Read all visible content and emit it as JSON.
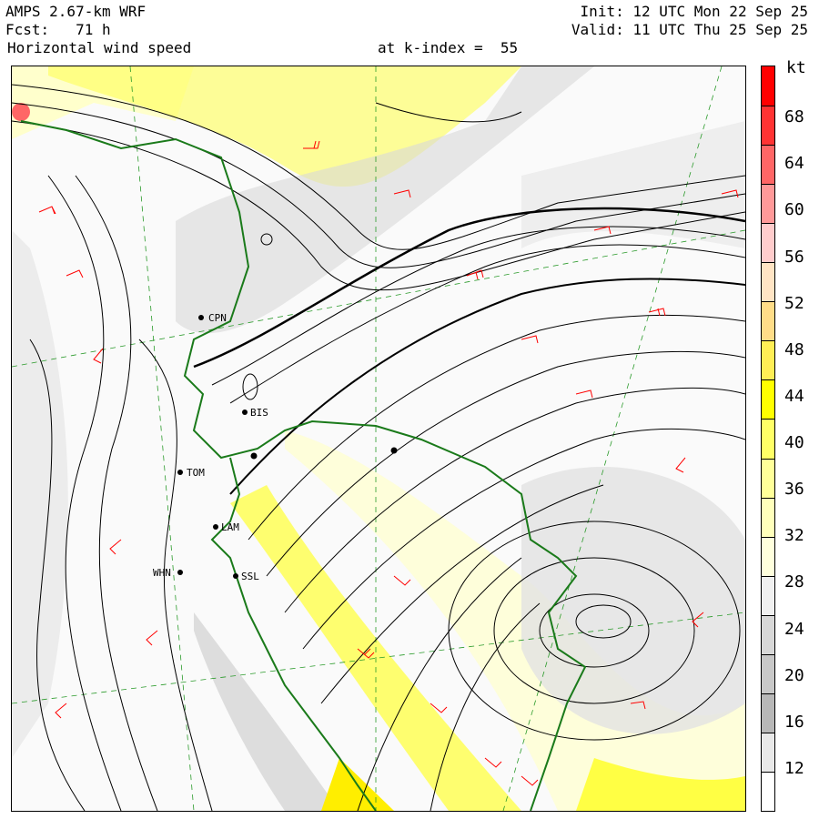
{
  "header": {
    "model": "AMPS 2.67-km WRF",
    "forecast_label": "Fcst:",
    "forecast_hours": "71 h",
    "field": "Horizontal wind speed",
    "level": "at k-index =  55",
    "init": "Init: 12 UTC Mon 22 Sep 25",
    "valid": "Valid: 11 UTC Thu 25 Sep 25"
  },
  "colorbar": {
    "unit": "kt",
    "tick_labels": [
      "68",
      "64",
      "60",
      "56",
      "52",
      "48",
      "44",
      "40",
      "36",
      "32",
      "28",
      "24",
      "20",
      "16",
      "12"
    ],
    "colors": [
      "#ff0000",
      "#ff3333",
      "#ff6666",
      "#ff9999",
      "#ffcccc",
      "#ffe4c4",
      "#ffdd88",
      "#ffee55",
      "#ffff00",
      "#ffff66",
      "#ffff99",
      "#ffffbb",
      "#ffffdd",
      "#f0f0f0",
      "#d8d8d8",
      "#c8c8c8",
      "#b8b8b8",
      "#e8e8e8",
      "#ffffff"
    ]
  },
  "stations": [
    {
      "code": "CPN"
    },
    {
      "code": "BIS"
    },
    {
      "code": "TOM"
    },
    {
      "code": "LAM"
    },
    {
      "code": "WHN"
    },
    {
      "code": "SSL"
    }
  ],
  "colors": {
    "coastline": "#1a7a1a",
    "barbs": "#ff0000",
    "streamlines": "#000000",
    "grid": "#2a9a2a"
  }
}
